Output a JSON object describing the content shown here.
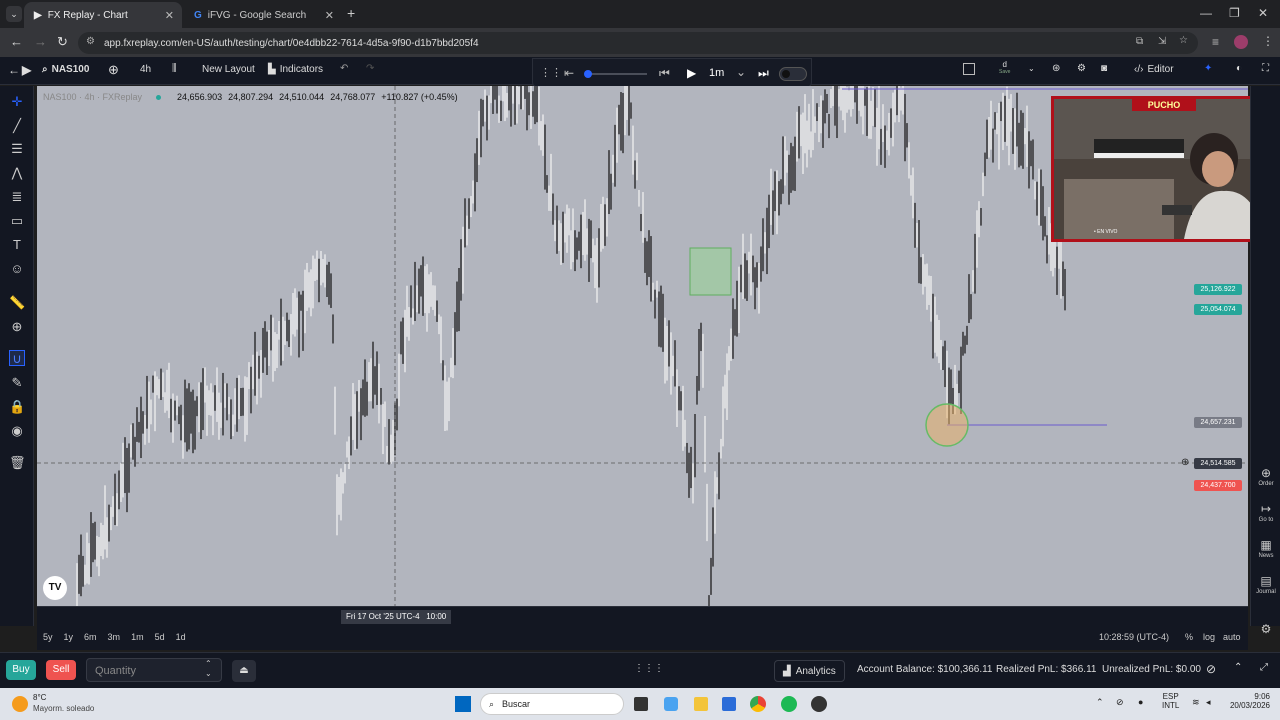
{
  "browser": {
    "tabs": [
      {
        "title": "FX Replay - Chart",
        "active": true
      },
      {
        "title": "iFVG - Google Search",
        "active": false
      }
    ],
    "url": "app.fxreplay.com/en-US/auth/testing/chart/0e4dbb22-7614-4d5a-9f90-d1b7bbd205f4"
  },
  "toolbar": {
    "symbol": "NAS100",
    "interval": "4h",
    "new_layout": "New Layout",
    "indicators": "Indicators",
    "speed": "1m",
    "range_label": "d",
    "range_sub": "Save",
    "editor": "Editor"
  },
  "legend": {
    "name": "NAS100 · 4h · FXReplay",
    "open": "24,656.903",
    "high": "24,807.294",
    "low": "24,510.044",
    "close": "24,768.077",
    "change": "+110.827 (+0.45%)"
  },
  "price_tags": [
    {
      "value": "25,126.922",
      "color": "#26a69a"
    },
    {
      "value": "25,054.074",
      "color": "#26a69a"
    },
    {
      "value": "24,657.231",
      "color": "#787b86"
    },
    {
      "value": "24,514.585",
      "color": "#363a45"
    },
    {
      "value": "24,437.700",
      "color": "#ef5350"
    }
  ],
  "crosshair_time": "Fri 17 Oct '25 UTC-4   10:00",
  "ranges": [
    "5y",
    "1y",
    "6m",
    "3m",
    "1m",
    "5d",
    "1d"
  ],
  "clock": "10:28:59 (UTC-4)",
  "scale": {
    "pct": "%",
    "log": "log",
    "auto": "auto"
  },
  "right_tools": [
    {
      "label": "Order",
      "icon": "⊕"
    },
    {
      "label": "Go to",
      "icon": "↦"
    },
    {
      "label": "News",
      "icon": "▦"
    },
    {
      "label": "Journal",
      "icon": "▤"
    }
  ],
  "trade": {
    "buy": "Buy",
    "sell": "Sell",
    "quantity_placeholder": "Quantity",
    "analytics": "Analytics",
    "balance": "Account Balance: $100,366.11",
    "realized": "Realized PnL: $366.11",
    "unrealized": "Unrealized PnL: $0.00"
  },
  "webcam": {
    "banner": "PUCHO",
    "live": "• EN VIVO"
  },
  "taskbar": {
    "temp": "8°C",
    "weather": "Mayorm. soleado",
    "search": "Buscar",
    "lang": "ESP",
    "layout": "INTL",
    "time": "9:06",
    "date": "20/03/2026"
  }
}
